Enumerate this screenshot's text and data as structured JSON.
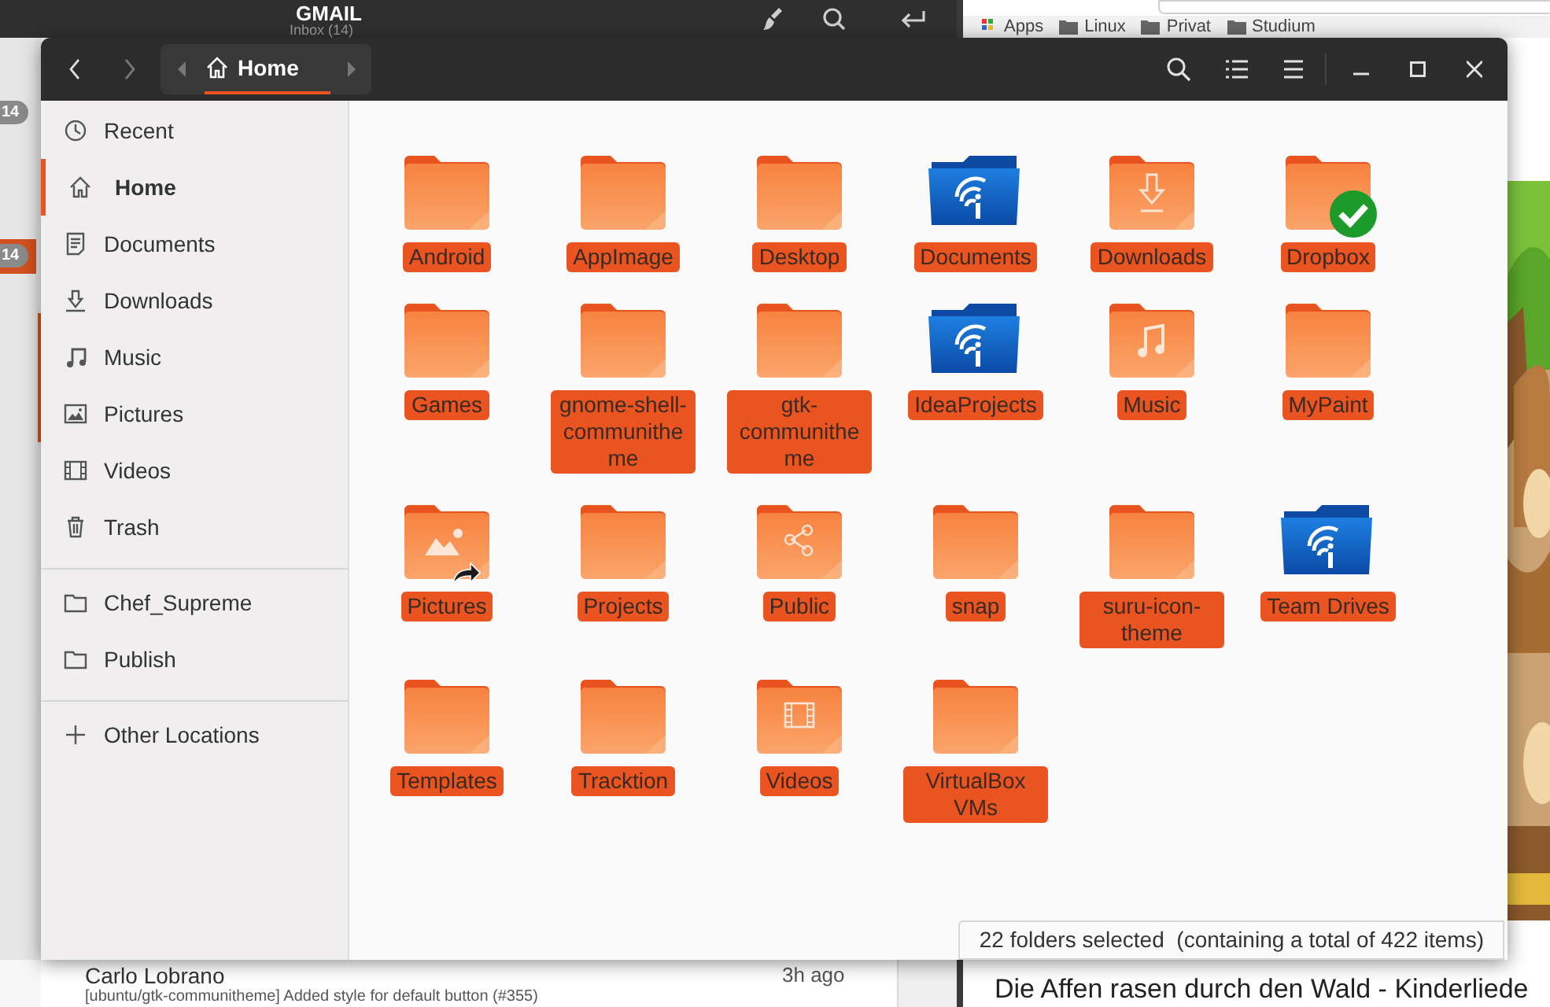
{
  "mail_window": {
    "title": "GMAIL",
    "subtitle": "Inbox (14)",
    "badges": [
      {
        "text": "14",
        "selected": false
      },
      {
        "text": "14",
        "selected": true
      }
    ],
    "message": {
      "sender": "Carlo Lobrano",
      "time": "3h ago",
      "subject": "[ubuntu/gtk-communitheme] Added style for default button (#355)"
    }
  },
  "browser_window": {
    "bookmarks": [
      "Apps",
      "Linux",
      "Privat",
      "Studium"
    ],
    "video_title": "Die Affen rasen durch den Wald - Kinderliede"
  },
  "files_window": {
    "path": "Home",
    "places": [
      {
        "label": "Recent",
        "kind": "recent",
        "selected": false
      },
      {
        "label": "Home",
        "kind": "home",
        "selected": true
      },
      {
        "label": "Documents",
        "kind": "documents",
        "selected": false
      },
      {
        "label": "Downloads",
        "kind": "downloads",
        "selected": false
      },
      {
        "label": "Music",
        "kind": "music",
        "selected": false
      },
      {
        "label": "Pictures",
        "kind": "pictures",
        "selected": false
      },
      {
        "label": "Videos",
        "kind": "videos",
        "selected": false
      },
      {
        "label": "Trash",
        "kind": "trash",
        "selected": false
      }
    ],
    "bookmarks": [
      {
        "label": "Chef_Supreme",
        "kind": "folder",
        "selected": false
      },
      {
        "label": "Publish",
        "kind": "folder",
        "selected": false
      }
    ],
    "other": [
      {
        "label": "Other Locations",
        "kind": "plus",
        "selected": false
      }
    ],
    "folders": [
      {
        "name": "Android",
        "kind": "plain",
        "selected": true
      },
      {
        "name": "AppImage",
        "kind": "plain",
        "selected": true
      },
      {
        "name": "Desktop",
        "kind": "plain",
        "selected": true
      },
      {
        "name": "Documents",
        "kind": "blue",
        "selected": true
      },
      {
        "name": "Downloads",
        "kind": "downloads",
        "selected": true
      },
      {
        "name": "Dropbox",
        "kind": "plain",
        "synced": true,
        "selected": true
      },
      {
        "name": "Games",
        "kind": "plain",
        "selected": true
      },
      {
        "name": "gnome-shell-communitheme",
        "kind": "plain",
        "selected": true
      },
      {
        "name": "gtk-communitheme",
        "kind": "plain",
        "selected": true
      },
      {
        "name": "IdeaProjects",
        "kind": "blue",
        "selected": true
      },
      {
        "name": "Music",
        "kind": "music",
        "selected": true
      },
      {
        "name": "MyPaint",
        "kind": "plain",
        "selected": true
      },
      {
        "name": "Pictures",
        "kind": "pictures",
        "shortcut": true,
        "selected": true
      },
      {
        "name": "Projects",
        "kind": "plain",
        "selected": true
      },
      {
        "name": "Public",
        "kind": "public",
        "selected": true
      },
      {
        "name": "snap",
        "kind": "plain",
        "selected": true
      },
      {
        "name": "suru-icon-theme",
        "kind": "plain",
        "selected": true
      },
      {
        "name": "Team Drives",
        "kind": "blue",
        "selected": true
      },
      {
        "name": "Templates",
        "kind": "plain",
        "selected": true
      },
      {
        "name": "Tracktion",
        "kind": "plain",
        "selected": true
      },
      {
        "name": "Videos",
        "kind": "videos",
        "selected": true
      },
      {
        "name": "VirtualBox VMs",
        "kind": "plain",
        "selected": true
      }
    ],
    "status": "22 folders selected  (containing a total of 422 items)"
  }
}
